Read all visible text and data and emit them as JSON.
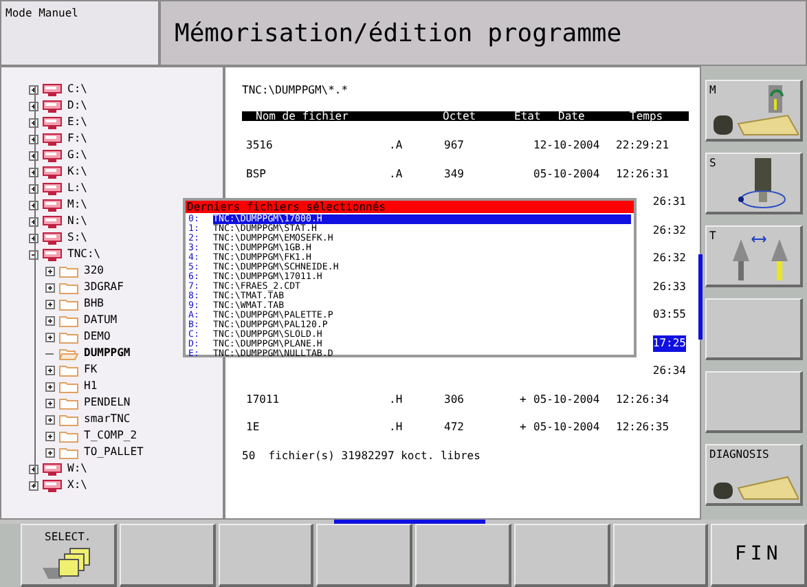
{
  "mode": "Mode Manuel",
  "title": "Mémorisation/édition programme",
  "tree": [
    {
      "kind": "drive",
      "label": "C:\\",
      "expanded": false,
      "selected": false
    },
    {
      "kind": "drive",
      "label": "D:\\",
      "expanded": false,
      "selected": false
    },
    {
      "kind": "drive",
      "label": "E:\\",
      "expanded": false,
      "selected": false
    },
    {
      "kind": "drive",
      "label": "F:\\",
      "expanded": false,
      "selected": false
    },
    {
      "kind": "drive",
      "label": "G:\\",
      "expanded": false,
      "selected": false
    },
    {
      "kind": "drive",
      "label": "K:\\",
      "expanded": false,
      "selected": false
    },
    {
      "kind": "drive",
      "label": "L:\\",
      "expanded": false,
      "selected": false
    },
    {
      "kind": "drive",
      "label": "M:\\",
      "expanded": false,
      "selected": false
    },
    {
      "kind": "drive",
      "label": "N:\\",
      "expanded": false,
      "selected": false
    },
    {
      "kind": "drive",
      "label": "S:\\",
      "expanded": false,
      "selected": false
    },
    {
      "kind": "drive",
      "label": "TNC:\\",
      "expanded": true,
      "selected": false,
      "children": [
        {
          "kind": "folder",
          "label": "320",
          "expanded": false,
          "selected": false
        },
        {
          "kind": "folder",
          "label": "3DGRAF",
          "expanded": false,
          "selected": false
        },
        {
          "kind": "folder",
          "label": "BHB",
          "expanded": false,
          "selected": false
        },
        {
          "kind": "folder",
          "label": "DATUM",
          "expanded": false,
          "selected": false
        },
        {
          "kind": "folder",
          "label": "DEMO",
          "expanded": false,
          "selected": false
        },
        {
          "kind": "folder",
          "label": "DUMPPGM",
          "expanded": false,
          "selected": true
        },
        {
          "kind": "folder",
          "label": "FK",
          "expanded": false,
          "selected": false
        },
        {
          "kind": "folder",
          "label": "H1",
          "expanded": false,
          "selected": false
        },
        {
          "kind": "folder",
          "label": "PENDELN",
          "expanded": false,
          "selected": false
        },
        {
          "kind": "folder",
          "label": "smarTNC",
          "expanded": false,
          "selected": false
        },
        {
          "kind": "folder",
          "label": "T_COMP_2",
          "expanded": false,
          "selected": false
        },
        {
          "kind": "folder",
          "label": "TO_PALLET",
          "expanded": false,
          "selected": false
        }
      ]
    },
    {
      "kind": "drive",
      "label": "W:\\",
      "expanded": false,
      "selected": false
    },
    {
      "kind": "drive",
      "label": "X:\\",
      "expanded": false,
      "selected": false
    }
  ],
  "files": {
    "path": "TNC:\\DUMPPGM\\*.*",
    "columns": [
      "Nom de fichier",
      "Octet",
      "Etat",
      "Date",
      "Temps"
    ],
    "rows": [
      {
        "kind": "full",
        "name": "3516",
        "ext": ".A",
        "size": "967",
        "status": "",
        "date": "12-10-2004",
        "time": "22:29:21",
        "selected": false
      },
      {
        "kind": "full",
        "name": "BSP",
        "ext": ".A",
        "size": "349",
        "status": "",
        "date": "05-10-2004",
        "time": "12:26:31",
        "selected": false
      },
      {
        "kind": "covered",
        "time": "26:31",
        "selected": false
      },
      {
        "kind": "covered",
        "time": "26:32",
        "selected": false
      },
      {
        "kind": "covered",
        "time": "26:32",
        "selected": false
      },
      {
        "kind": "covered",
        "time": "26:33",
        "selected": false
      },
      {
        "kind": "covered",
        "time": "03:55",
        "selected": false
      },
      {
        "kind": "covered",
        "time": "17:25",
        "selected": true
      },
      {
        "kind": "covered",
        "time": "26:34",
        "selected": false
      },
      {
        "kind": "full",
        "name": "17011",
        "ext": ".H",
        "size": "306",
        "status": "+",
        "date": "05-10-2004",
        "time": "12:26:34",
        "selected": false
      },
      {
        "kind": "full",
        "name": "1E",
        "ext": ".H",
        "size": "472",
        "status": "+",
        "date": "05-10-2004",
        "time": "12:26:35",
        "selected": false
      }
    ],
    "footer": "50  fichier(s) 31982297 koct. libres"
  },
  "popup": {
    "title": "Derniers fichiers sélectionnés",
    "items": [
      {
        "key": "0:",
        "path": "TNC:\\DUMPPGM\\17000.H",
        "selected": true
      },
      {
        "key": "1:",
        "path": "TNC:\\DUMPPGM\\STAT.H",
        "selected": false
      },
      {
        "key": "2:",
        "path": "TNC:\\DUMPPGM\\EMOSEFK.H",
        "selected": false
      },
      {
        "key": "3:",
        "path": "TNC:\\DUMPPGM\\1GB.H",
        "selected": false
      },
      {
        "key": "4:",
        "path": "TNC:\\DUMPPGM\\FK1.H",
        "selected": false
      },
      {
        "key": "5:",
        "path": "TNC:\\DUMPPGM\\SCHNEIDE.H",
        "selected": false
      },
      {
        "key": "6:",
        "path": "TNC:\\DUMPPGM\\17011.H",
        "selected": false
      },
      {
        "key": "7:",
        "path": "TNC:\\FRAES_2.CDT",
        "selected": false
      },
      {
        "key": "8:",
        "path": "TNC:\\TMAT.TAB",
        "selected": false
      },
      {
        "key": "9:",
        "path": "TNC:\\WMAT.TAB",
        "selected": false
      },
      {
        "key": "A:",
        "path": "TNC:\\DUMPPGM\\PALETTE.P",
        "selected": false
      },
      {
        "key": "B:",
        "path": "TNC:\\DUMPPGM\\PAL120.P",
        "selected": false
      },
      {
        "key": "C:",
        "path": "TNC:\\DUMPPGM\\SLOLD.H",
        "selected": false
      },
      {
        "key": "D:",
        "path": "TNC:\\DUMPPGM\\PLANE.H",
        "selected": false
      },
      {
        "key": "E:",
        "path": "TNC:\\DUMPPGM\\NULLTAB.D",
        "selected": false
      }
    ]
  },
  "side_softkeys": [
    {
      "kind": "machine",
      "label": "M"
    },
    {
      "kind": "spindle",
      "label": "S"
    },
    {
      "kind": "tool",
      "label": "T"
    },
    {
      "kind": "blank"
    },
    {
      "kind": "blank"
    },
    {
      "kind": "diagnosis",
      "label": "DIAGNOSIS"
    }
  ],
  "bottom_softkeys": [
    {
      "kind": "select",
      "label": "SELECT."
    },
    {
      "kind": "blank"
    },
    {
      "kind": "blank"
    },
    {
      "kind": "blank"
    },
    {
      "kind": "blank"
    },
    {
      "kind": "blank"
    },
    {
      "kind": "blank"
    },
    {
      "kind": "end",
      "label": "FIN"
    }
  ]
}
